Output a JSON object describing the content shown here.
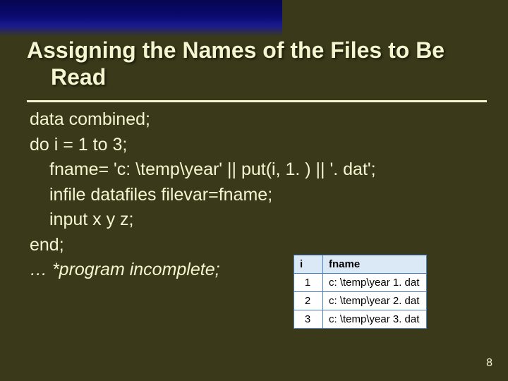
{
  "title": {
    "line1": "Assigning the Names of the Files to Be",
    "line2": "Read"
  },
  "code": {
    "l1": "data combined;",
    "l2": "do i = 1 to 3;",
    "l3": "fname= 'c: \\temp\\year' || put(i, 1. ) || '. dat';",
    "l4": "infile datafiles filevar=fname;",
    "l5": "input x y z;",
    "l6": "end;",
    "note": "… *program incomplete;"
  },
  "table": {
    "headers": {
      "c0": "i",
      "c1": "fname"
    },
    "rows": [
      {
        "c0": "1",
        "c1": "c: \\temp\\year 1. dat"
      },
      {
        "c0": "2",
        "c1": "c: \\temp\\year 2. dat"
      },
      {
        "c0": "3",
        "c1": "c: \\temp\\year 3. dat"
      }
    ]
  },
  "page_number": "8"
}
